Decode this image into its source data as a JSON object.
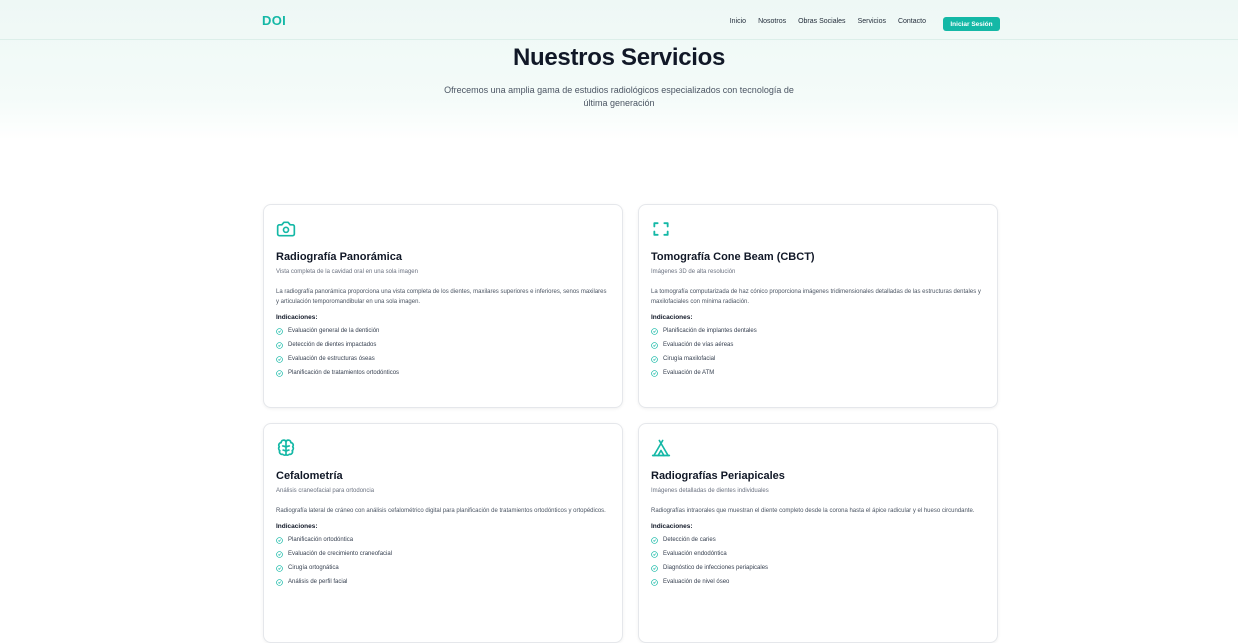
{
  "nav": {
    "logo": "DOI",
    "links": [
      "Inicio",
      "Nosotros",
      "Obras Sociales",
      "Servicios",
      "Contacto"
    ],
    "login_label": "Iniciar Sesión"
  },
  "hero": {
    "title": "Nuestros Servicios",
    "subtitle": "Ofrecemos una amplia gama de estudios radiológicos especializados con tecnología de última generación"
  },
  "indications_label": "Indicaciones:",
  "colors": {
    "accent": "#14b8a6"
  },
  "services": [
    {
      "icon": "camera-icon",
      "title": "Radiografía Panorámica",
      "subtitle": "Vista completa de la cavidad oral en una sola imagen",
      "description": "La radiografía panorámica proporciona una vista completa de los dientes, maxilares superiores e inferiores, senos maxilares y articulación temporomandibular en una sola imagen.",
      "indications": [
        "Evaluación general de la dentición",
        "Detección de dientes impactados",
        "Evaluación de estructuras óseas",
        "Planificación de tratamientos ortodónticos"
      ]
    },
    {
      "icon": "scan-icon",
      "title": "Tomografía Cone Beam (CBCT)",
      "subtitle": "Imágenes 3D de alta resolución",
      "description": "La tomografía computarizada de haz cónico proporciona imágenes tridimensionales detalladas de las estructuras dentales y maxilofaciales con mínima radiación.",
      "indications": [
        "Planificación de implantes dentales",
        "Evaluación de vías aéreas",
        "Cirugía maxilofacial",
        "Evaluación de ATM"
      ]
    },
    {
      "icon": "brain-icon",
      "title": "Cefalometría",
      "subtitle": "Análisis craneofacial para ortodoncia",
      "description": "Radiografía lateral de cráneo con análisis cefalométrico digital para planificación de tratamientos ortodónticos y ortopédicos.",
      "indications": [
        "Planificación ortodóntica",
        "Evaluación de crecimiento craneofacial",
        "Cirugía ortognática",
        "Análisis de perfil facial"
      ]
    },
    {
      "icon": "tent-icon",
      "title": "Radiografías Periapicales",
      "subtitle": "Imágenes detalladas de dientes individuales",
      "description": "Radiografías intraorales que muestran el diente completo desde la corona hasta el ápice radicular y el hueso circundante.",
      "indications": [
        "Detección de caries",
        "Evaluación endodóntica",
        "Diagnóstico de infecciones periapicales",
        "Evaluación de nivel óseo"
      ]
    }
  ]
}
